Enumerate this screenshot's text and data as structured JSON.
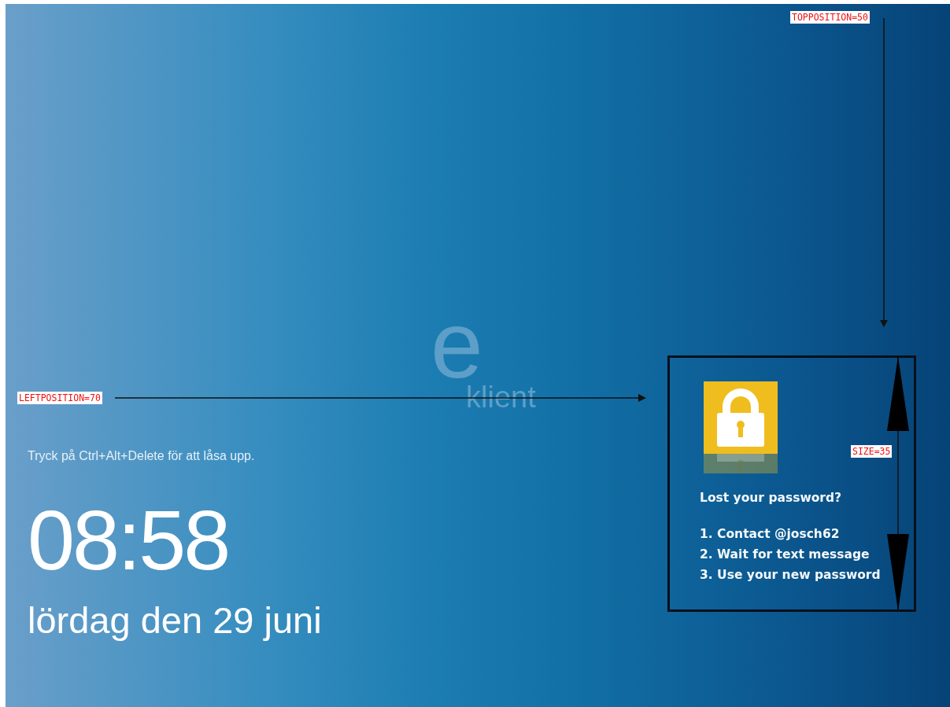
{
  "lock_screen": {
    "logo": {
      "letter": "e",
      "word": "klient"
    },
    "hint": "Tryck på Ctrl+Alt+Delete för att låsa upp.",
    "time": "08:58",
    "date": "lördag den 29 juni"
  },
  "info_box": {
    "title": "Lost your password?",
    "steps": [
      "1. Contact @josch62",
      "2. Wait for text message",
      "3. Use your new password"
    ]
  },
  "annotations": [
    {
      "kind": "vertical",
      "label": "TOPPOSITION=50"
    },
    {
      "kind": "horizontal",
      "label": "LEFTPOSITION=70"
    },
    {
      "kind": "size",
      "label": "SIZE=35"
    }
  ]
}
